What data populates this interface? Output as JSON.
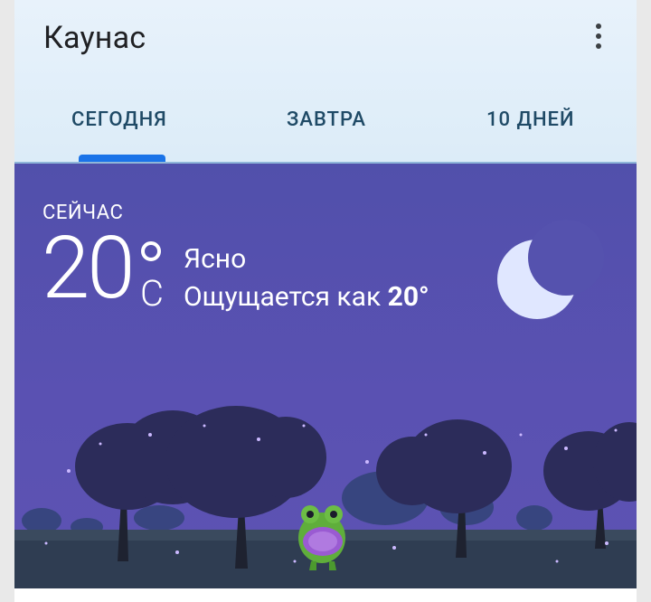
{
  "location": {
    "city": "Каунас"
  },
  "menu": {
    "icon": "more-vert-icon"
  },
  "tabs": [
    {
      "label": "СЕГОДНЯ",
      "active": true
    },
    {
      "label": "ЗАВТРА",
      "active": false
    },
    {
      "label": "10 ДНЕЙ",
      "active": false
    }
  ],
  "current": {
    "label": "СЕЙЧАС",
    "temp": "20",
    "unit": "C",
    "condition": "Ясно",
    "feels_like_prefix": "Ощущается как",
    "feels_like_value": "20°"
  },
  "colors": {
    "header_bg": "#e3eff9",
    "tab_accent": "#1a73e8",
    "scene_bg": "#5552ae",
    "moon": "#dfe7ff"
  }
}
